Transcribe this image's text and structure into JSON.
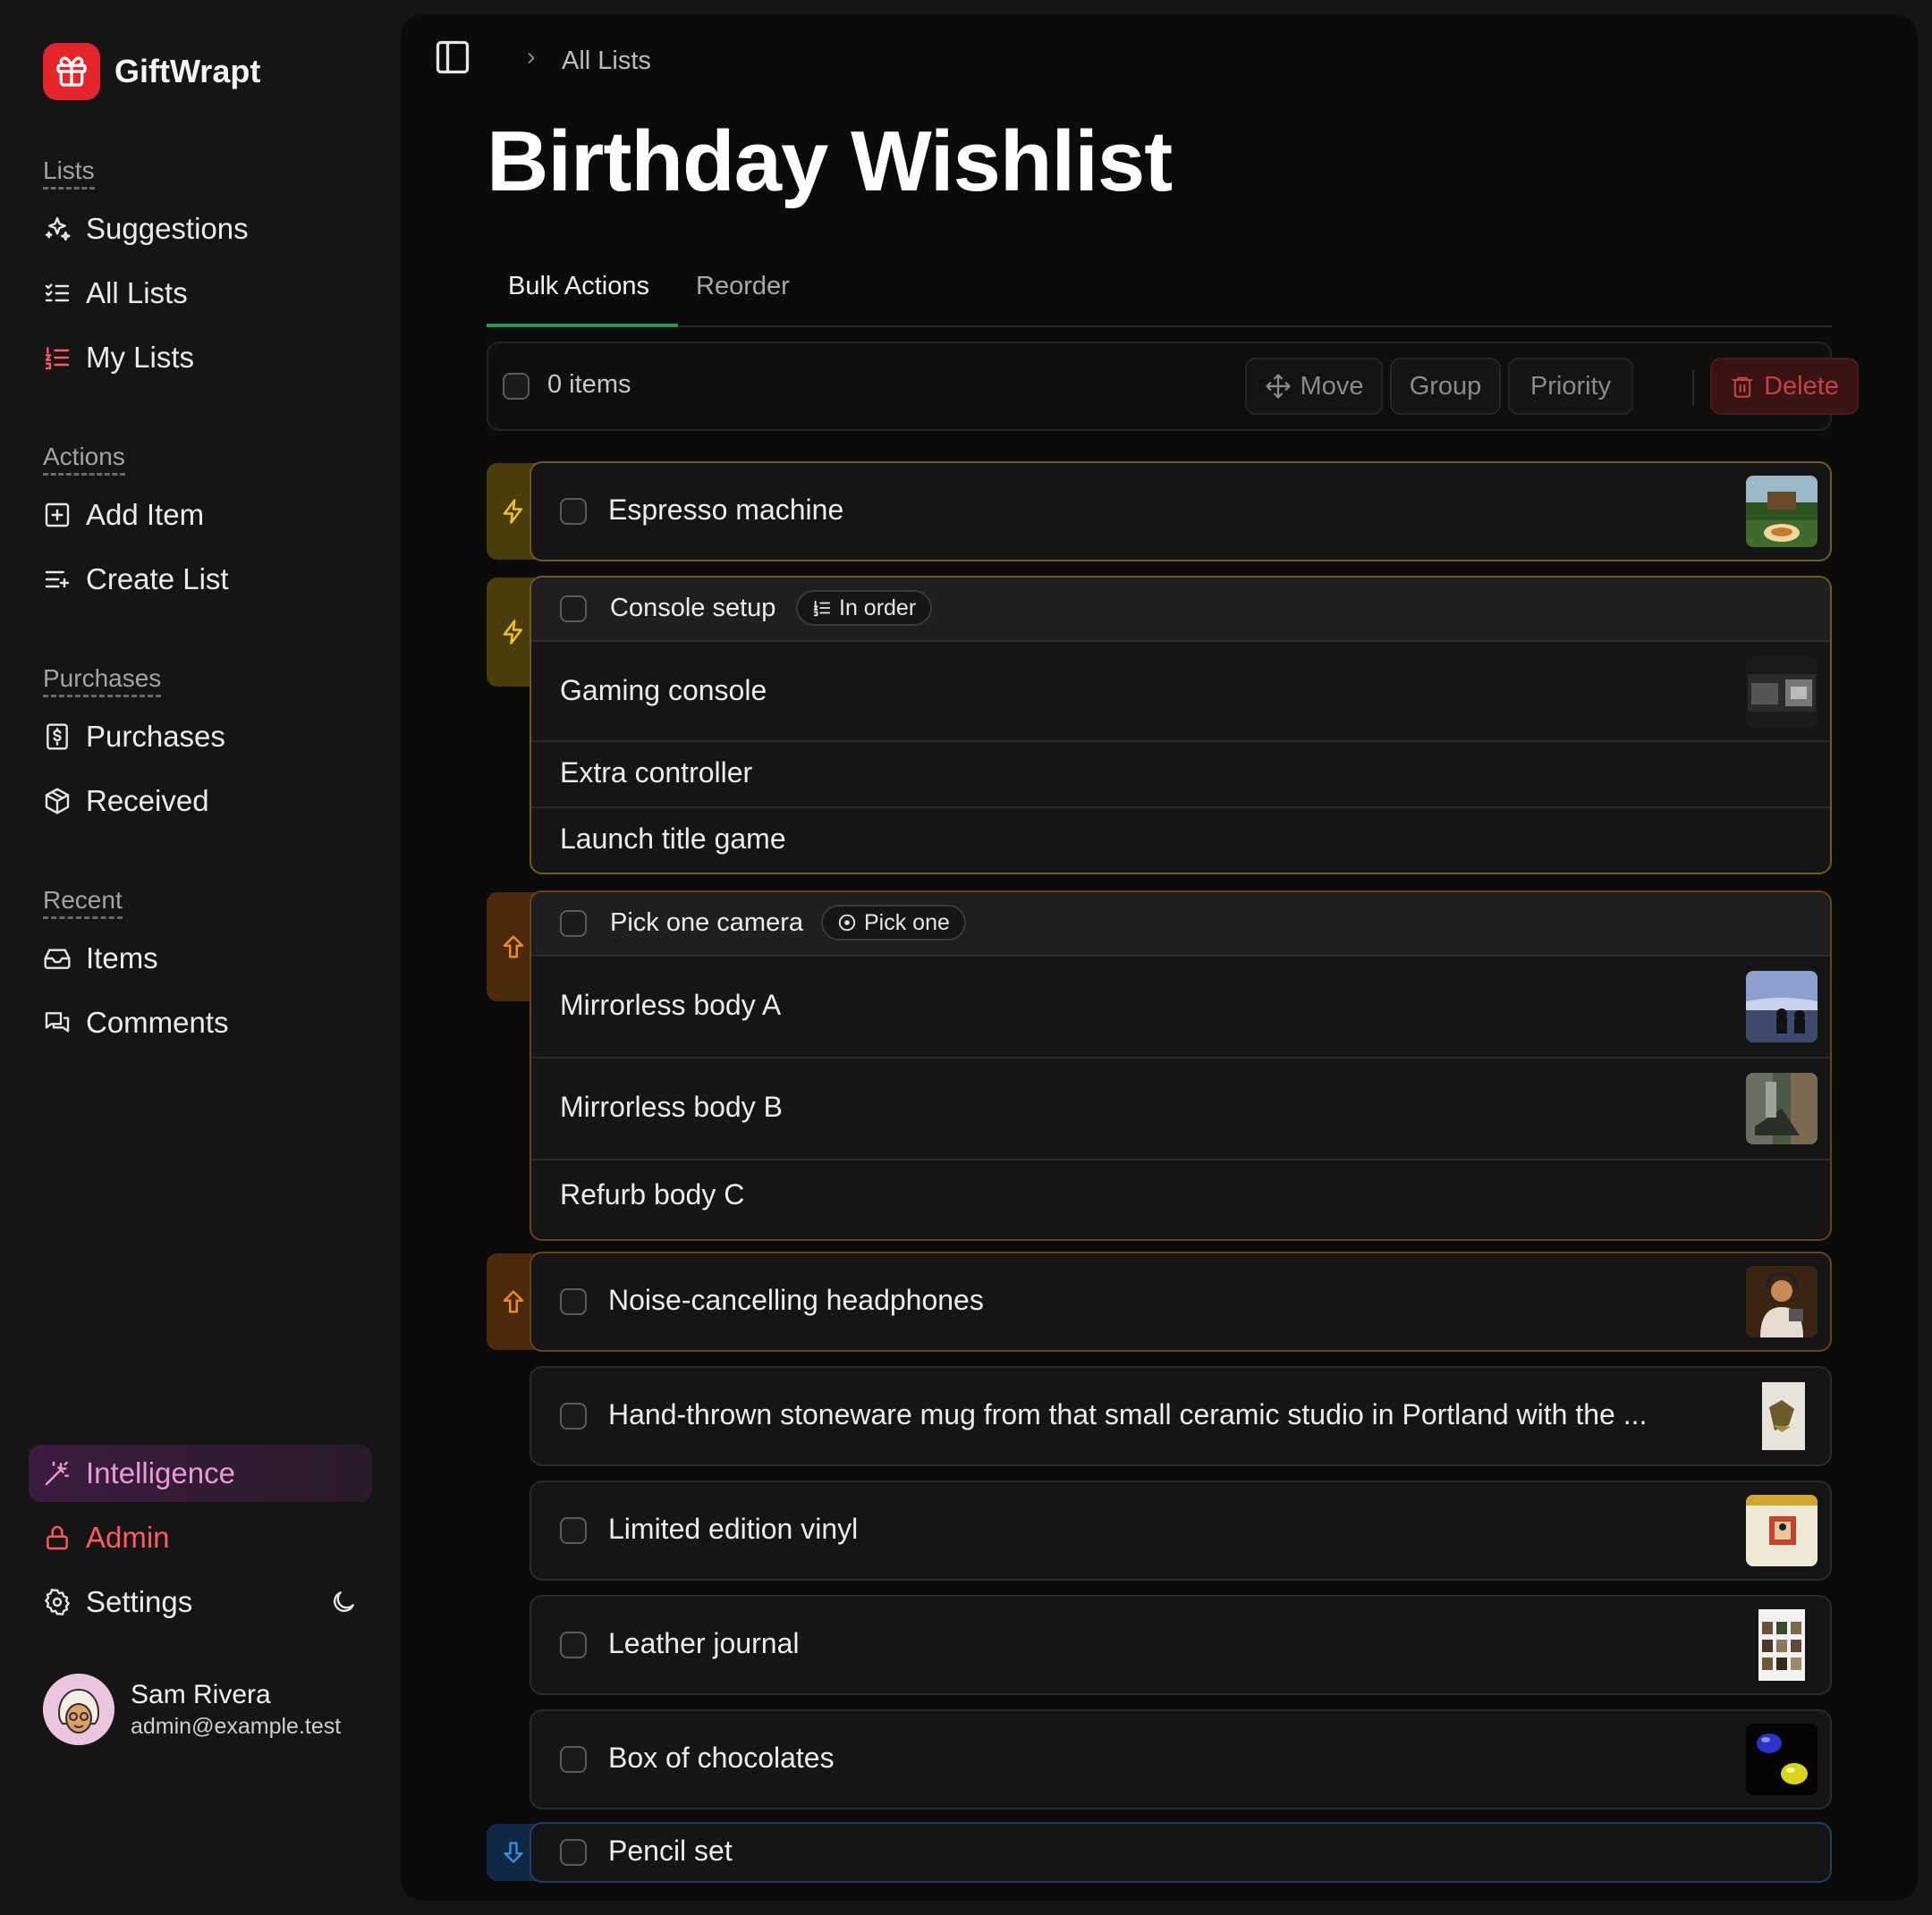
{
  "app": {
    "name": "GiftWrapt"
  },
  "sidebar": {
    "sections": {
      "lists": "Lists",
      "actions": "Actions",
      "purchases": "Purchases",
      "recent": "Recent"
    },
    "items": {
      "suggestions": "Suggestions",
      "all_lists": "All Lists",
      "my_lists": "My Lists",
      "add_item": "Add Item",
      "create_list": "Create List",
      "purchases": "Purchases",
      "received": "Received",
      "items": "Items",
      "comments": "Comments",
      "intelligence": "Intelligence",
      "admin": "Admin",
      "settings": "Settings"
    },
    "user": {
      "name": "Sam Rivera",
      "email": "admin@example.test"
    }
  },
  "header": {
    "breadcrumb": "All Lists",
    "title": "Birthday Wishlist"
  },
  "tabs": [
    {
      "label": "Bulk Actions",
      "active": true
    },
    {
      "label": "Reorder",
      "active": false
    }
  ],
  "bulk": {
    "count_label": "0 items",
    "move": "Move",
    "group": "Group",
    "priority": "Priority",
    "delete": "Delete"
  },
  "list": {
    "espresso": "Espresso machine",
    "console_group": {
      "title": "Console setup",
      "badge": "In order",
      "items": [
        "Gaming console",
        "Extra controller",
        "Launch title game"
      ]
    },
    "camera_group": {
      "title": "Pick one camera",
      "badge": "Pick one",
      "items": [
        "Mirrorless body A",
        "Mirrorless body B",
        "Refurb body C"
      ]
    },
    "headphones": "Noise-cancelling headphones",
    "mug": "Hand-thrown stoneware mug from that small ceramic studio in Portland with the ...",
    "vinyl": "Limited edition vinyl",
    "journal": "Leather journal",
    "chocolates": "Box of chocolates",
    "pencils": "Pencil set"
  },
  "colors": {
    "brand": "#e5252b",
    "tab_active": "#1f9a55",
    "priority_high": "#f0c419",
    "priority_medium": "#f08a24",
    "priority_low": "#3b8de0",
    "admin": "#ff5a5f",
    "intelligence": "#e79ad6"
  }
}
